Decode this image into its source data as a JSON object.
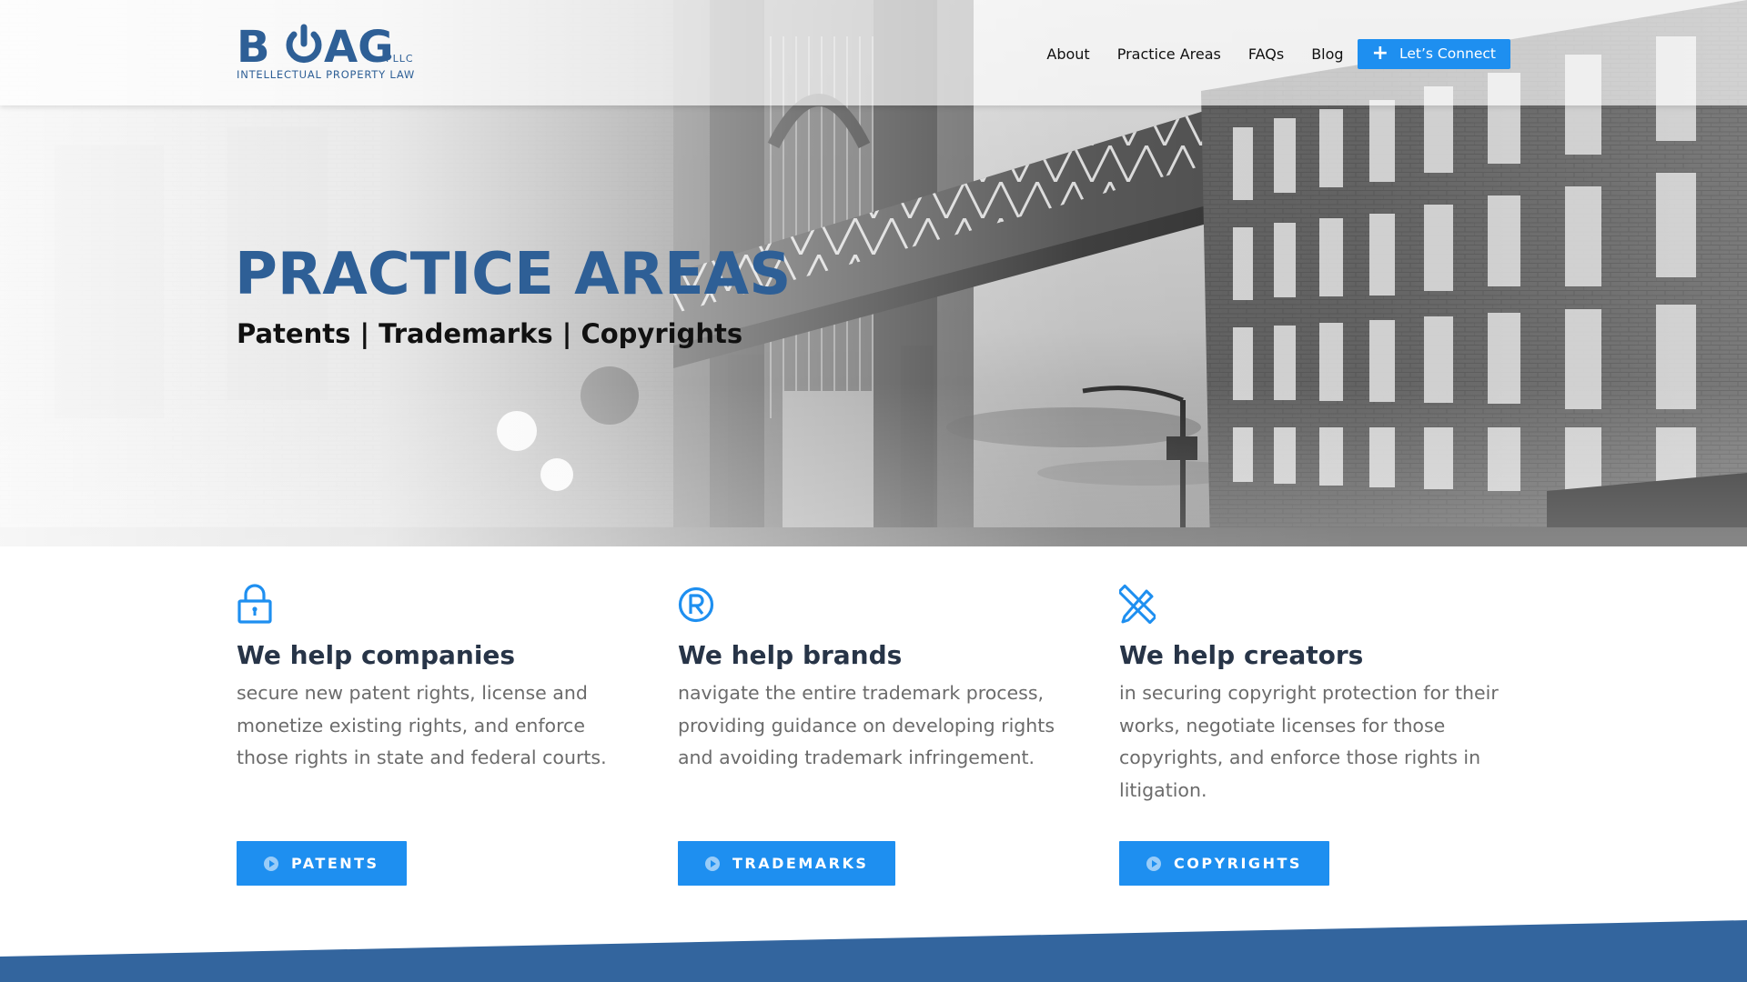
{
  "header": {
    "logo": {
      "word": "BOAG",
      "suffix": "PLLC",
      "tagline": "INTELLECTUAL  PROPERTY  LAW"
    },
    "nav": [
      {
        "label": "About"
      },
      {
        "label": "Practice Areas"
      },
      {
        "label": "FAQs"
      },
      {
        "label": "Blog"
      }
    ],
    "cta": {
      "label": "Let’s Connect",
      "icon": "plus-icon"
    }
  },
  "hero": {
    "title": "PRACTICE AREAS",
    "subtitle": "Patents | Trademarks | Copyrights",
    "background": "grayscale photo of bridge between brick buildings"
  },
  "services": [
    {
      "icon": "lock-icon",
      "heading": "We help companies",
      "body": "secure new patent rights, license and monetize existing rights, and enforce those rights in state and federal courts.",
      "button": "PATENTS"
    },
    {
      "icon": "registered-trademark-icon",
      "heading": "We help brands",
      "body": "navigate the entire trademark process, providing guidance on developing rights and avoiding trademark infringement.",
      "button": "TRADEMARKS"
    },
    {
      "icon": "pencil-ruler-icon",
      "heading": "We help creators",
      "body": "in securing copyright protection for their works, negotiate licenses for those copyrights, and enforce those rights in litigation.",
      "button": "COPYRIGHTS"
    }
  ],
  "colors": {
    "brand_blue": "#2e5f96",
    "accent_blue": "#1e8ff0",
    "heading_dark": "#273447",
    "body_gray": "#6b6b6b",
    "band_blue": "#33659e"
  }
}
